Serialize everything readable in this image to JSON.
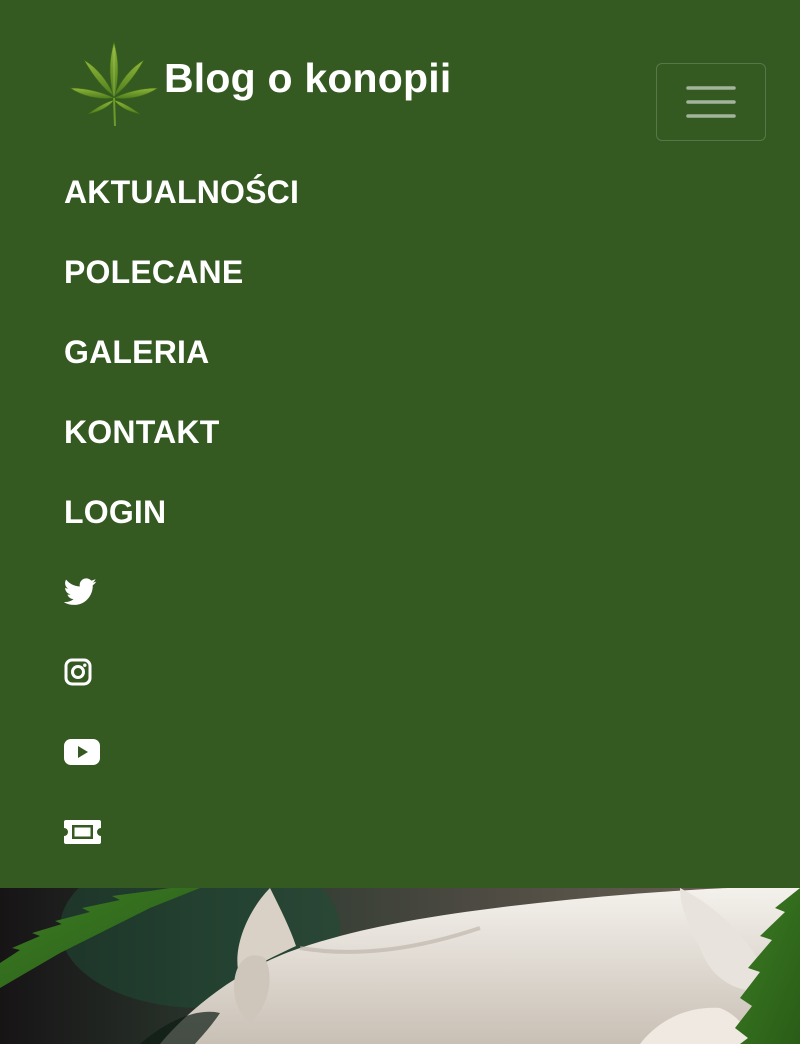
{
  "brand": {
    "logo_icon": "cannabis-leaf-icon",
    "title": "Blog o konopii"
  },
  "menu_toggle": {
    "icon": "hamburger-menu-icon"
  },
  "nav": {
    "items": [
      {
        "label": "AKTUALNOŚCI"
      },
      {
        "label": "POLECANE"
      },
      {
        "label": "GALERIA"
      },
      {
        "label": "KONTAKT"
      },
      {
        "label": "LOGIN"
      }
    ]
  },
  "social": {
    "items": [
      {
        "icon": "twitter-icon"
      },
      {
        "icon": "instagram-icon"
      },
      {
        "icon": "youtube-icon"
      },
      {
        "icon": "ticket-icon"
      }
    ]
  },
  "colors": {
    "navbar_bg": "#345a22",
    "text": "#ffffff",
    "toggle_border": "rgba(255,255,255,0.18)"
  },
  "hero": {
    "image": "hero-photo-hemp-leaf-and-hand"
  }
}
